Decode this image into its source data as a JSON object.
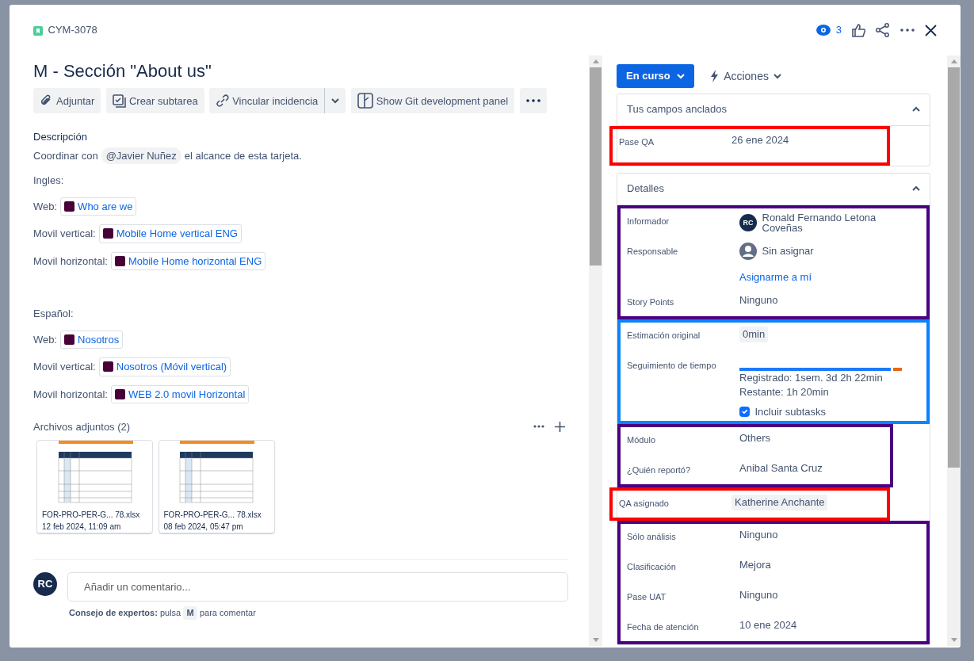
{
  "issue": {
    "key": "CYM-3078",
    "title": "M - Sección \"About us\""
  },
  "header": {
    "watchers": "3"
  },
  "toolbar": [
    {
      "kind": "attach",
      "label": "Adjuntar",
      "dropdown": false
    },
    {
      "kind": "subtask",
      "label": "Crear subtarea",
      "dropdown": false
    },
    {
      "kind": "link",
      "label": "Vincular incidencia",
      "dropdown": true
    },
    {
      "kind": "git",
      "label": "Show Git development panel",
      "dropdown": false
    },
    {
      "kind": "more"
    }
  ],
  "description": {
    "heading": "Descripción",
    "intro": {
      "before": "Coordinar con",
      "mention": "@Javier Nuñez",
      "after": "el alcance de esta tarjeta."
    },
    "sections": [
      {
        "heading": "Ingles:",
        "links": [
          {
            "label": "Web:",
            "link": "Who are we"
          },
          {
            "label": "Movil vertical:",
            "link": "Mobile Home vertical ENG"
          },
          {
            "label": "Movil horizontal:",
            "link": "Mobile Home horizontal ENG"
          }
        ]
      },
      {
        "heading": "Español:",
        "links": [
          {
            "label": "Web:",
            "link": "Nosotros"
          },
          {
            "label": "Movil vertical:",
            "link": "Nosotros (Móvil vertical)"
          },
          {
            "label": "Movil horizontal:",
            "link": "WEB 2.0 movil Horizontal"
          }
        ]
      }
    ]
  },
  "attachments": {
    "title": "Archivos adjuntos (2)",
    "files": [
      {
        "name": "FOR-PRO-PER-G... 78.xlsx",
        "date": "12 feb 2024, 11:09 am"
      },
      {
        "name": "FOR-PRO-PER-G... 78.xlsx",
        "date": "08 feb 2024, 05:47 pm"
      }
    ]
  },
  "comment": {
    "avatar": "RC",
    "placeholder": "Añadir un comentario...",
    "tip": "**Consejo de expertos:** pulsa",
    "key": "M",
    "tip_after": "para comentar"
  },
  "status": {
    "label": "En curso"
  },
  "actions": {
    "label": "Acciones"
  },
  "pinned": {
    "title": "Tus campos anclados",
    "expanded": true,
    "groups": [
      {
        "color": "#ff0000",
        "fields": [
          {
            "kind": "text",
            "label": "Pase QA",
            "value": "26 ene 2024"
          }
        ]
      }
    ]
  },
  "details": {
    "title": "Detalles",
    "expanded": true,
    "groups": [
      {
        "color": "#4b0082",
        "fields": [
          {
            "kind": "user",
            "label": "Informador",
            "value": "Ronald Fernando Letona Coveñas",
            "avatar": "RC"
          },
          {
            "kind": "unassigned",
            "label": "Responsable",
            "value": "Sin asignar",
            "link": "Asignarme a mí"
          },
          {
            "kind": "text",
            "label": "Story Points",
            "value": "Ninguno"
          }
        ]
      },
      {
        "color": "#0a84ff",
        "fields": [
          {
            "kind": "pill",
            "label": "Estimación original",
            "value": "0min"
          },
          {
            "kind": "time",
            "label": "Seguimiento de tiempo",
            "level": 0.93,
            "logged": "Registrado: 1sem. 3d 2h 22min",
            "remaining": "Restante: 1h 20min",
            "option": "Incluir subtasks",
            "checked": true
          }
        ]
      },
      {
        "color": "#4b0082",
        "fields": [
          {
            "kind": "text",
            "label": "Módulo",
            "value": "Others"
          },
          {
            "kind": "text",
            "label": "¿Quién reportó?",
            "value": "Anibal Santa Cruz"
          }
        ]
      },
      {
        "color": "#ff0000",
        "fields": [
          {
            "kind": "pill",
            "label": "QA asignado",
            "value": "Katherine Anchante"
          }
        ]
      },
      {
        "color": "#4b0082",
        "fields": [
          {
            "kind": "text",
            "label": "Sólo análisis",
            "value": "Ninguno"
          },
          {
            "kind": "text",
            "label": "Clasificación",
            "value": "Mejora"
          },
          {
            "kind": "text",
            "label": "Pase UAT",
            "value": "Ninguno"
          },
          {
            "kind": "text",
            "label": "Fecha de atención",
            "value": "10 ene 2024"
          }
        ]
      }
    ]
  }
}
